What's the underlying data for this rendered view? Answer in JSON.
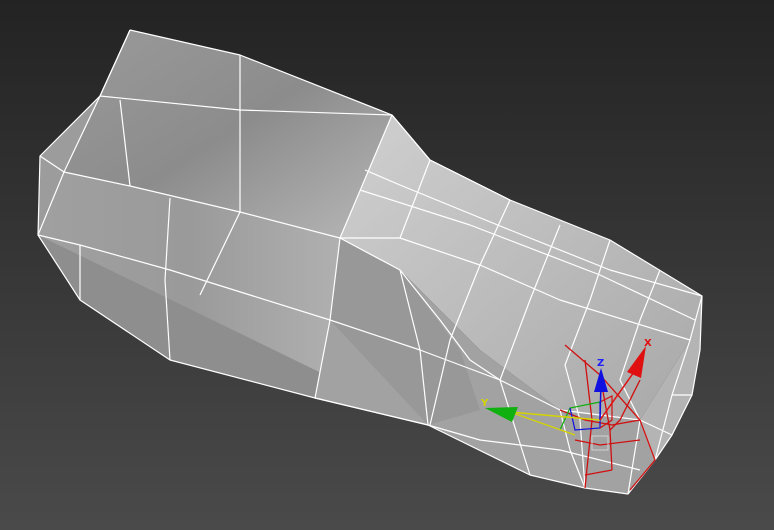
{
  "viewport": {
    "background_top": "#232323",
    "background_bottom": "#4a4a4a"
  },
  "mesh": {
    "face_light": "#c8c8c8",
    "face_mid": "#a8a8a8",
    "face_dark": "#8a8a8a",
    "edge_color": "#ffffff"
  },
  "gizmo": {
    "x_label": "X",
    "y_label": "Y",
    "z_label": "Z",
    "x_color": "#e01010",
    "y_color": "#10b010",
    "z_color": "#1010e0",
    "plane_colors": [
      "#d4d400",
      "#10b010",
      "#e01010"
    ],
    "selection_color": "#d01010"
  }
}
